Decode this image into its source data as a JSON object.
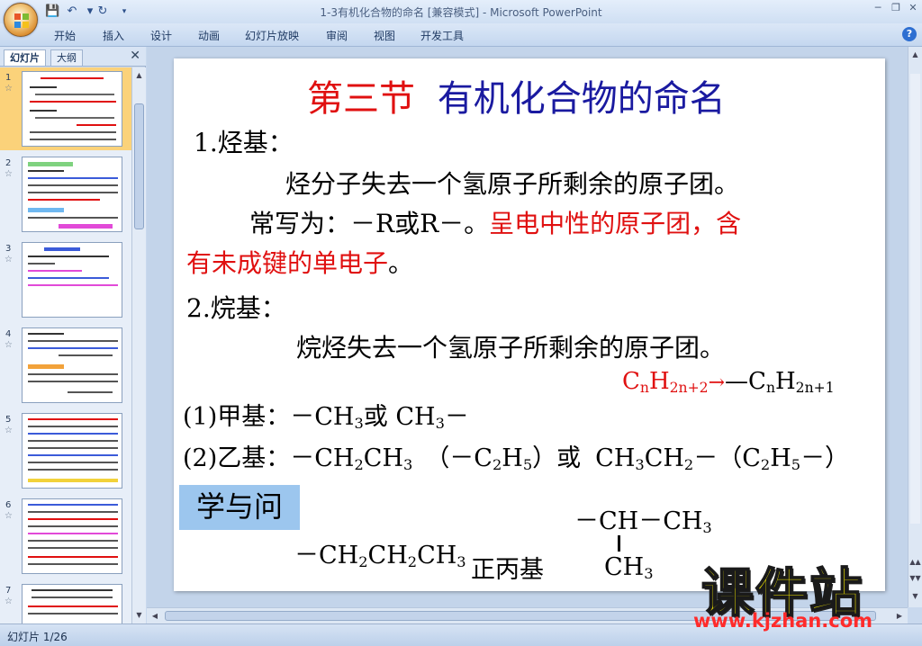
{
  "window": {
    "title": "1-3有机化合物的命名 [兼容模式] - Microsoft PowerPoint"
  },
  "ribbon": {
    "tabs": [
      "开始",
      "插入",
      "设计",
      "动画",
      "幻灯片放映",
      "审阅",
      "视图",
      "开发工具"
    ]
  },
  "left_panel": {
    "tab_slides": "幻灯片",
    "tab_outline": "大纲",
    "thumb_numbers": [
      "1",
      "2",
      "3",
      "4",
      "5",
      "6",
      "7"
    ],
    "selected_index": 1
  },
  "slide": {
    "title_prefix": "第三节",
    "title_main": "有机化合物的命名",
    "s1_heading": "1.烃基：",
    "s1_def": "烃分子失去一个氢原子所剩余的原子团。",
    "s1_written_black": "常写为：－R或R－。",
    "s1_written_red": "呈电中性的原子团，含",
    "s1_line3_red": "有未成键的单电子",
    "s1_line3_end": "。",
    "s2_heading": "2.烷基：",
    "s2_def": "烷烃失去一个氢原子所剩余的原子团。",
    "formula_left": {
      "c": "C",
      "n": "n",
      "h": "H",
      "sub": "2n+2"
    },
    "formula_arrow": "→",
    "formula_right": {
      "dash": "—",
      "c": "C",
      "n": "n",
      "h": "H",
      "sub": "2n+1"
    },
    "methyl": {
      "label": "(1)甲基：",
      "f1": "－CH",
      "s1": "3",
      "or": "或",
      "f2": " CH",
      "s2": "3",
      "f2end": "－"
    },
    "ethyl": {
      "label": "(2)乙基：",
      "a": "－CH",
      "a_sub": "2",
      "b": "CH",
      "b_sub": "3",
      "p_open": "（－C",
      "p_sub1": "2",
      "p_h": "H",
      "p_sub2": "5",
      "p_close": "）",
      "or": "或",
      "c": "CH",
      "c_sub": "3",
      "d": "CH",
      "d_sub": "2",
      "d_end": "－",
      "q_open": "（C",
      "q_sub1": "2",
      "q_h": "H",
      "q_sub2": "5",
      "q_close": "－）"
    },
    "question_box": "学与问",
    "propyl_formula": {
      "a": "－CH",
      "a_sub": "2",
      "b": "CH",
      "b_sub": "2",
      "c": "CH",
      "c_sub": "3"
    },
    "propyl_name": "正丙基",
    "isopropyl": {
      "top": "－CH－CH",
      "top_sub": "3",
      "bottom": "CH",
      "bottom_sub": "3"
    }
  },
  "status_bar": {
    "text": "幻灯片 1/26"
  },
  "watermark": {
    "big": "课件站",
    "url": "www.kjzhan.com"
  },
  "colors": {
    "title_red": "#e01010",
    "title_blue": "#1a1aa0",
    "question_bg": "#9cc6ee",
    "watermark_yellow": "#f2e600",
    "watermark_red": "#ff2b2b"
  }
}
